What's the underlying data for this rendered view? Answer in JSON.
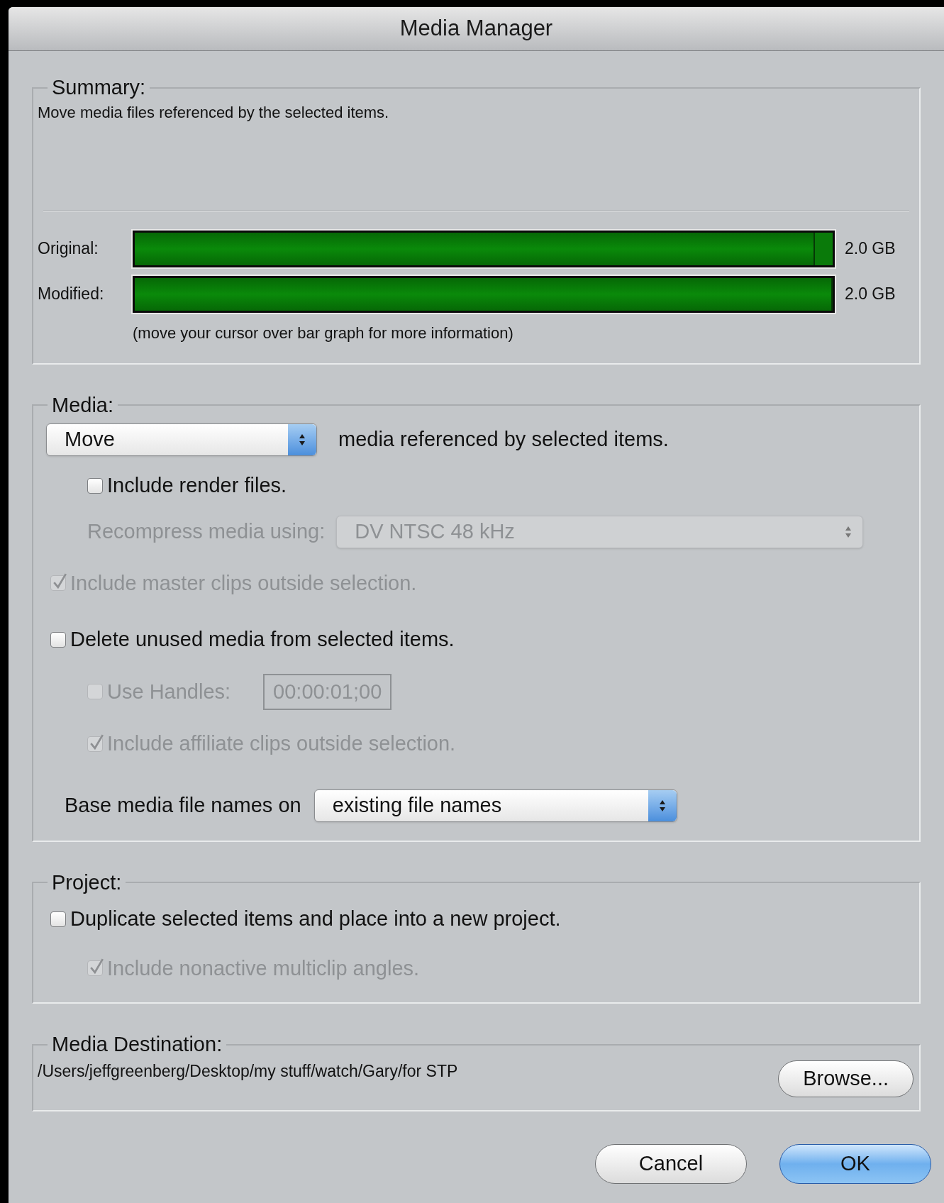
{
  "window": {
    "title": "Media Manager"
  },
  "summary": {
    "title": "Summary:",
    "description": "Move media files referenced by the selected items.",
    "bars": [
      {
        "label": "Original:",
        "level": 0.975,
        "reading": "2.0 GB"
      },
      {
        "label": "Modified:",
        "level": 1,
        "reading": "2.0 GB"
      }
    ],
    "hint": "(move your cursor over bar graph for more information)"
  },
  "media": {
    "title": "Media:",
    "action_popup": {
      "value": "Move",
      "disabled": false
    },
    "action_text": "media referenced by selected items.",
    "include_render": {
      "label": "Include render files.",
      "checked": false,
      "disabled": false
    },
    "recompress": {
      "label": "Recompress media using:",
      "value": "DV NTSC 48 kHz",
      "disabled": true
    },
    "include_master": {
      "label": "Include master clips outside selection.",
      "checked": true,
      "disabled": true
    },
    "delete_unused": {
      "label": "Delete unused media from selected items.",
      "checked": false,
      "disabled": false,
      "children": [
        {
          "kind": "field",
          "label": "Use Handles:",
          "checked": false,
          "disabled": true,
          "value": "00:00:01;00"
        },
        {
          "kind": "plain",
          "label": "Include affiliate clips outside selection.",
          "checked": true,
          "disabled": true
        }
      ]
    },
    "base_names": {
      "label": "Base media file names on",
      "value": "existing file names",
      "disabled": false
    }
  },
  "project": {
    "title": "Project:",
    "duplicate": {
      "label": "Duplicate selected items and place into a new project.",
      "checked": false,
      "disabled": false
    },
    "include_nonactive": {
      "label": "Include nonactive multiclip angles.",
      "checked": true,
      "disabled": true
    }
  },
  "destination": {
    "title": "Media Destination:",
    "path": "/Users/jeffgreenberg/Desktop/my stuff/watch/Gary/for STP",
    "browse": "Browse..."
  },
  "buttons": [
    {
      "label": "Cancel",
      "default": false
    },
    {
      "label": "OK",
      "default": true
    }
  ]
}
